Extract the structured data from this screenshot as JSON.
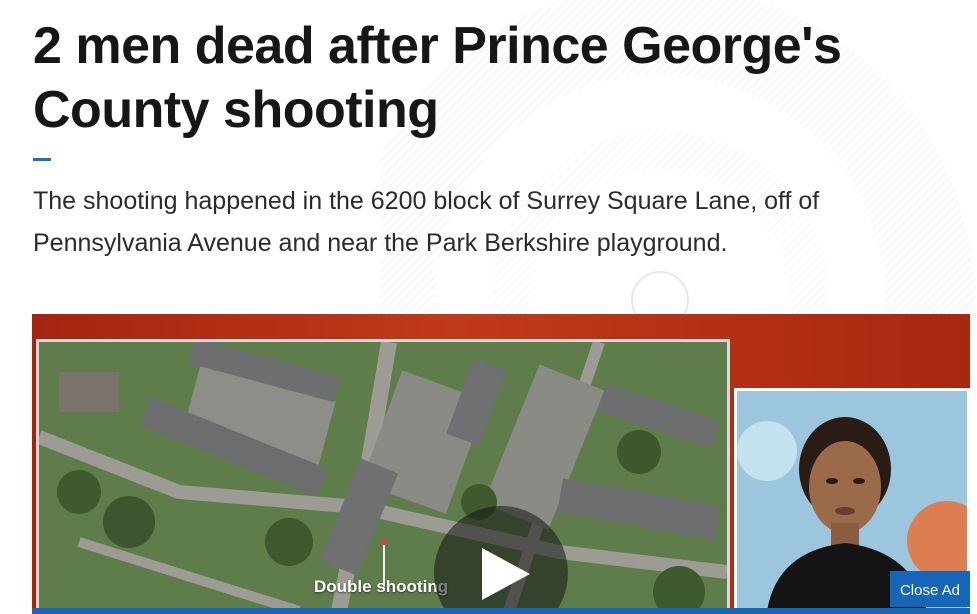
{
  "article": {
    "headline": "2 men dead after Prince George's County shooting",
    "dek_line1": "The shooting happened in the 6200 block of Surrey Square Lane, off of",
    "dek_line2": "Pennsylvania Avenue and near the Park Berkshire playground."
  },
  "video": {
    "lower_third": "Double shooting",
    "play_icon": "play-icon"
  },
  "ad": {
    "close_label": "Close Ad"
  },
  "colors": {
    "accent": "#1473c2",
    "video_red": "#b3301a",
    "ad_blue": "#1565b8"
  }
}
